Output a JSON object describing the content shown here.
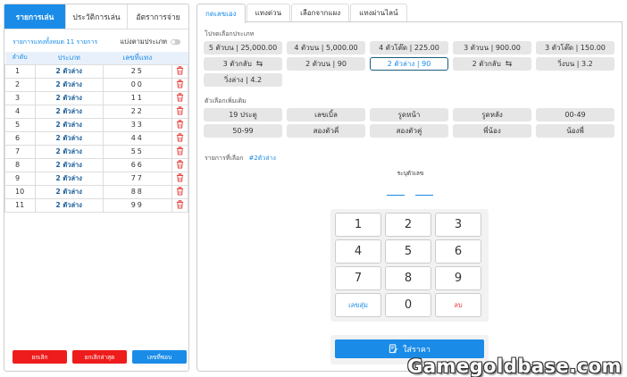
{
  "left": {
    "tabs": [
      "รายการเล่น",
      "ประวัติการเล่น",
      "อัตราการจ่าย"
    ],
    "summary": "รายการแทงทั้งหมด 11 รายการ",
    "toggle_label": "แบ่งตามประเภท",
    "columns": [
      "ลำดับ",
      "ประเภท",
      "เลขที่แทง"
    ],
    "rows": [
      {
        "no": "1",
        "type": "2 ตัวล่าง",
        "num": "25"
      },
      {
        "no": "2",
        "type": "2 ตัวล่าง",
        "num": "00"
      },
      {
        "no": "3",
        "type": "2 ตัวล่าง",
        "num": "11"
      },
      {
        "no": "4",
        "type": "2 ตัวล่าง",
        "num": "22"
      },
      {
        "no": "5",
        "type": "2 ตัวล่าง",
        "num": "33"
      },
      {
        "no": "6",
        "type": "2 ตัวล่าง",
        "num": "44"
      },
      {
        "no": "7",
        "type": "2 ตัวล่าง",
        "num": "55"
      },
      {
        "no": "8",
        "type": "2 ตัวล่าง",
        "num": "66"
      },
      {
        "no": "9",
        "type": "2 ตัวล่าง",
        "num": "77"
      },
      {
        "no": "10",
        "type": "2 ตัวล่าง",
        "num": "88"
      },
      {
        "no": "11",
        "type": "2 ตัวล่าง",
        "num": "99"
      }
    ],
    "buttons": {
      "cancel": "ยกเลิก",
      "cancel_last": "ยกเลิกล่าสุด",
      "repeat": "เลขที่ซอบ"
    }
  },
  "right": {
    "tabs": [
      "กดเลขเอง",
      "แทงด่วน",
      "เลือกจากแผง",
      "แทงผ่านไลน์"
    ],
    "type_label": "โปรดเลือกประเภท",
    "types": [
      {
        "label": "5 ตัวบน | 25,000.00",
        "arrow": false
      },
      {
        "label": "4 ตัวบน | 5,000.00",
        "arrow": false
      },
      {
        "label": "4 ตัวโต๊ด | 225.00",
        "arrow": false
      },
      {
        "label": "3 ตัวบน | 900.00",
        "arrow": false
      },
      {
        "label": "3 ตัวโต๊ด | 150.00",
        "arrow": false
      },
      {
        "label": "3 ตัวกลับ",
        "arrow": true
      },
      {
        "label": "2 ตัวบน | 90",
        "arrow": false
      },
      {
        "label": "2 ตัวล่าง | 90",
        "arrow": false
      },
      {
        "label": "2 ตัวกลับ",
        "arrow": true
      },
      {
        "label": "วิ่งบน | 3.2",
        "arrow": false
      },
      {
        "label": "วิ่งล่าง | 4.2",
        "arrow": false
      }
    ],
    "selected_index": 7,
    "extra_label": "ตัวเลือกเพิ่มเติม",
    "extras": [
      "19 ประตู",
      "เลขเบิ้ล",
      "รูดหน้า",
      "รูดหลัง",
      "00-49",
      "50-99",
      "สองตัวคี่",
      "สองตัวคู่",
      "พี่น้อง",
      "น้องพี่"
    ],
    "picked_label": "รายการที่เลือก",
    "picked_value": "#2ตัวล่าง",
    "hint": "ระบุตัวเลข",
    "keys": [
      "1",
      "2",
      "3",
      "4",
      "5",
      "6",
      "7",
      "8",
      "9",
      "เลขสุ่ม",
      "0",
      "ลบ"
    ],
    "price_button": "ใส่ราคา"
  },
  "watermark": "Gamegoldbase.com",
  "colors": {
    "accent": "#1a8ce8",
    "danger": "#ee1c1c"
  }
}
